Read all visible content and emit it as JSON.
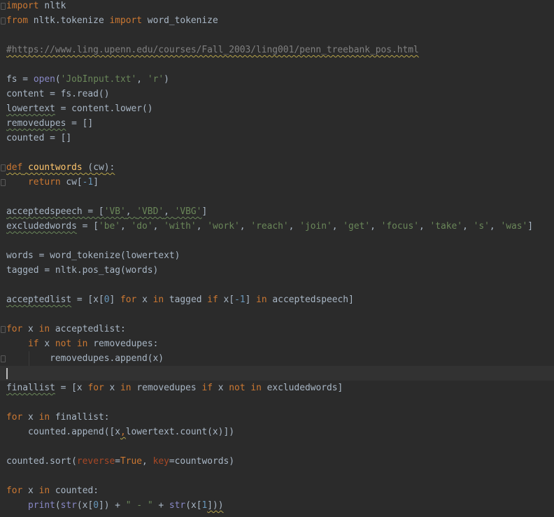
{
  "editor": {
    "colors": {
      "background": "#2b2b2b",
      "current_line": "#323232",
      "default_text": "#a9b7c6",
      "keyword": "#cc7832",
      "string": "#6a8759",
      "number": "#6897bb",
      "builtin": "#8888c6",
      "function_name": "#ffc66d",
      "parameter": "#aa4926",
      "comment": "#808080"
    },
    "lines": [
      [
        {
          "t": "kw",
          "v": "import"
        },
        {
          "t": "",
          "v": " nltk"
        }
      ],
      [
        {
          "t": "kw",
          "v": "from"
        },
        {
          "t": "",
          "v": " nltk.tokenize "
        },
        {
          "t": "kw",
          "v": "import"
        },
        {
          "t": "",
          "v": " word_tokenize"
        }
      ],
      [],
      [
        {
          "t": "com",
          "v": "#https://www.ling.upenn.edu/courses/Fall_2003/ling001/penn_treebank_pos.html",
          "u": "wavy-y"
        }
      ],
      [],
      [
        {
          "t": "",
          "v": "fs = "
        },
        {
          "t": "bi",
          "v": "open"
        },
        {
          "t": "",
          "v": "("
        },
        {
          "t": "str",
          "v": "'JobInput.txt'"
        },
        {
          "t": "",
          "v": ", "
        },
        {
          "t": "str",
          "v": "'r'"
        },
        {
          "t": "",
          "v": ")"
        }
      ],
      [
        {
          "t": "",
          "v": "content = fs.read()"
        }
      ],
      [
        {
          "t": "",
          "v": "lowertext",
          "u": "wavy"
        },
        {
          "t": "",
          "v": " = content.lower()"
        }
      ],
      [
        {
          "t": "",
          "v": "removedupes",
          "u": "wavy"
        },
        {
          "t": "",
          "v": " = []"
        }
      ],
      [
        {
          "t": "",
          "v": "counted = []"
        }
      ],
      [],
      [
        {
          "t": "kw",
          "v": "def",
          "u": "wavy-y"
        },
        {
          "t": "",
          "v": " ",
          "u": "wavy-y"
        },
        {
          "t": "fn",
          "v": "countwords",
          "u": "wavy-y"
        },
        {
          "t": "",
          "v": " (",
          "u": "wavy-y"
        },
        {
          "t": "",
          "v": "cw",
          "u": "wavy-y"
        },
        {
          "t": "",
          "v": "):",
          "u": "wavy-y"
        }
      ],
      [
        {
          "t": "",
          "v": "    "
        },
        {
          "t": "kw",
          "v": "return"
        },
        {
          "t": "",
          "v": " cw["
        },
        {
          "t": "num",
          "v": "-1"
        },
        {
          "t": "",
          "v": "]"
        }
      ],
      [],
      [
        {
          "t": "",
          "v": "acceptedspeech = [",
          "u": "wavy"
        },
        {
          "t": "str",
          "v": "'VB'",
          "u": "wavy"
        },
        {
          "t": "",
          "v": ", ",
          "u": "wavy"
        },
        {
          "t": "str",
          "v": "'VBD'",
          "u": "wavy"
        },
        {
          "t": "",
          "v": ", ",
          "u": "wavy"
        },
        {
          "t": "str",
          "v": "'VBG'",
          "u": "wavy"
        },
        {
          "t": "",
          "v": "]"
        }
      ],
      [
        {
          "t": "",
          "v": "excludedwords",
          "u": "wavy"
        },
        {
          "t": "",
          "v": " = ["
        },
        {
          "t": "str",
          "v": "'be'"
        },
        {
          "t": "",
          "v": ", "
        },
        {
          "t": "str",
          "v": "'do'"
        },
        {
          "t": "",
          "v": ", "
        },
        {
          "t": "str",
          "v": "'with'"
        },
        {
          "t": "",
          "v": ", "
        },
        {
          "t": "str",
          "v": "'work'"
        },
        {
          "t": "",
          "v": ", "
        },
        {
          "t": "str",
          "v": "'reach'"
        },
        {
          "t": "",
          "v": ", "
        },
        {
          "t": "str",
          "v": "'join'"
        },
        {
          "t": "",
          "v": ", "
        },
        {
          "t": "str",
          "v": "'get'"
        },
        {
          "t": "",
          "v": ", "
        },
        {
          "t": "str",
          "v": "'focus'"
        },
        {
          "t": "",
          "v": ", "
        },
        {
          "t": "str",
          "v": "'take'"
        },
        {
          "t": "",
          "v": ", "
        },
        {
          "t": "str",
          "v": "'s'"
        },
        {
          "t": "",
          "v": ", "
        },
        {
          "t": "str",
          "v": "'was'"
        },
        {
          "t": "",
          "v": "]"
        }
      ],
      [],
      [
        {
          "t": "",
          "v": "words = word_tokenize(lowertext)"
        }
      ],
      [
        {
          "t": "",
          "v": "tagged = nltk.pos_tag(words)"
        }
      ],
      [],
      [
        {
          "t": "",
          "v": "acceptedlist",
          "u": "wavy"
        },
        {
          "t": "",
          "v": " = [x["
        },
        {
          "t": "num",
          "v": "0"
        },
        {
          "t": "",
          "v": "] "
        },
        {
          "t": "kw",
          "v": "for"
        },
        {
          "t": "",
          "v": " x "
        },
        {
          "t": "kw",
          "v": "in"
        },
        {
          "t": "",
          "v": " tagged "
        },
        {
          "t": "kw",
          "v": "if"
        },
        {
          "t": "",
          "v": " x["
        },
        {
          "t": "num",
          "v": "-1"
        },
        {
          "t": "",
          "v": "] "
        },
        {
          "t": "kw",
          "v": "in"
        },
        {
          "t": "",
          "v": " acceptedspeech]"
        }
      ],
      [],
      [
        {
          "t": "kw",
          "v": "for"
        },
        {
          "t": "",
          "v": " x "
        },
        {
          "t": "kw",
          "v": "in"
        },
        {
          "t": "",
          "v": " acceptedlist:"
        }
      ],
      [
        {
          "t": "",
          "v": "    "
        },
        {
          "t": "kw",
          "v": "if"
        },
        {
          "t": "",
          "v": " x "
        },
        {
          "t": "kw",
          "v": "not in"
        },
        {
          "t": "",
          "v": " removedupes:"
        }
      ],
      [
        {
          "t": "",
          "v": "        removedupes.append(x)"
        }
      ],
      [
        {
          "caret": true
        }
      ],
      [
        {
          "t": "",
          "v": "finallist",
          "u": "wavy"
        },
        {
          "t": "",
          "v": " = [x "
        },
        {
          "t": "kw",
          "v": "for"
        },
        {
          "t": "",
          "v": " x "
        },
        {
          "t": "kw",
          "v": "in"
        },
        {
          "t": "",
          "v": " removedupes "
        },
        {
          "t": "kw",
          "v": "if"
        },
        {
          "t": "",
          "v": " x "
        },
        {
          "t": "kw",
          "v": "not in"
        },
        {
          "t": "",
          "v": " excludedwords]"
        }
      ],
      [],
      [
        {
          "t": "kw",
          "v": "for"
        },
        {
          "t": "",
          "v": " x "
        },
        {
          "t": "kw",
          "v": "in"
        },
        {
          "t": "",
          "v": " finallist:"
        }
      ],
      [
        {
          "t": "",
          "v": "    counted.append([x"
        },
        {
          "t": "kw",
          "v": ",",
          "u": "wavy-y"
        },
        {
          "t": "",
          "v": "lowertext.count(x)])"
        }
      ],
      [],
      [
        {
          "t": "",
          "v": "counted.sort("
        },
        {
          "t": "par",
          "v": "reverse"
        },
        {
          "t": "",
          "v": "="
        },
        {
          "t": "kw",
          "v": "True"
        },
        {
          "t": "",
          "v": ", "
        },
        {
          "t": "par",
          "v": "key"
        },
        {
          "t": "",
          "v": "=countwords)"
        }
      ],
      [],
      [
        {
          "t": "kw",
          "v": "for"
        },
        {
          "t": "",
          "v": " x "
        },
        {
          "t": "kw",
          "v": "in"
        },
        {
          "t": "",
          "v": " counted:"
        }
      ],
      [
        {
          "t": "",
          "v": "    "
        },
        {
          "t": "bi",
          "v": "print"
        },
        {
          "t": "",
          "v": "("
        },
        {
          "t": "bi",
          "v": "str"
        },
        {
          "t": "",
          "v": "(x["
        },
        {
          "t": "num",
          "v": "0"
        },
        {
          "t": "",
          "v": "]) + "
        },
        {
          "t": "str",
          "v": "\" - \""
        },
        {
          "t": "",
          "v": " + "
        },
        {
          "t": "bi",
          "v": "str"
        },
        {
          "t": "",
          "v": "(x["
        },
        {
          "t": "num",
          "v": "1"
        },
        {
          "t": "",
          "v": "]))",
          "u": "wavy-y"
        }
      ]
    ]
  }
}
